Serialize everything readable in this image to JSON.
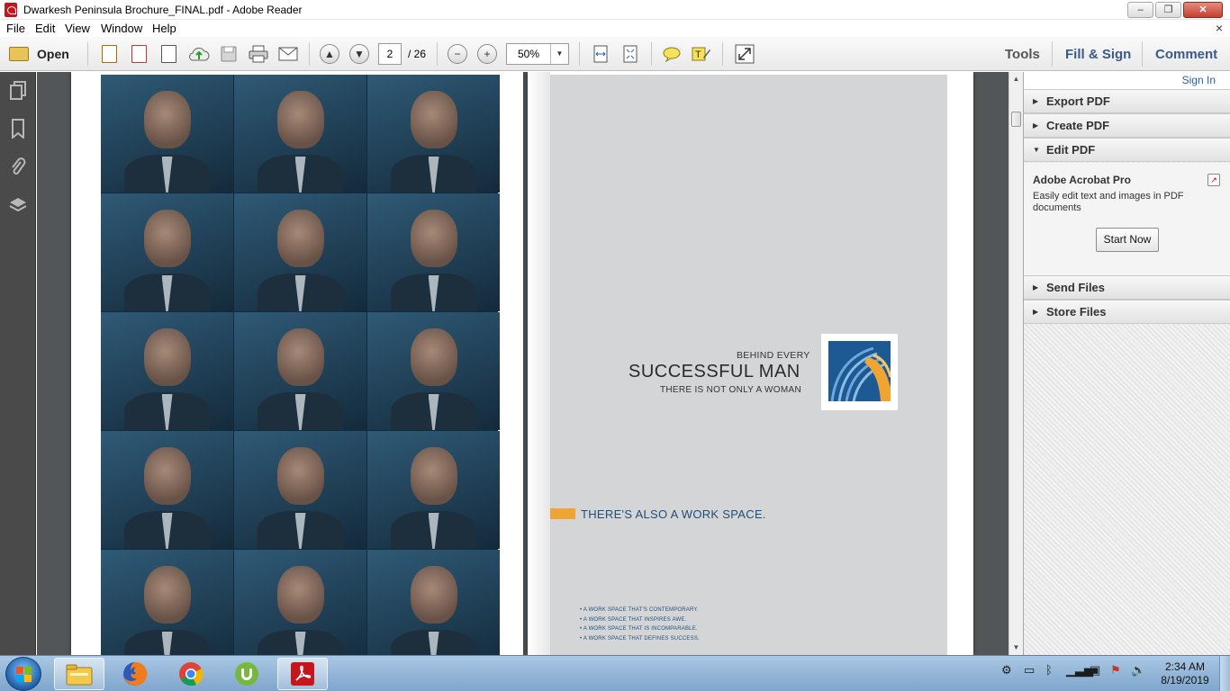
{
  "window": {
    "title": "Dwarkesh Peninsula Brochure_FINAL.pdf - Adobe Reader",
    "minimize": "–",
    "restore": "❐",
    "close": "✕"
  },
  "menu": {
    "items": [
      "File",
      "Edit",
      "View",
      "Window",
      "Help"
    ],
    "close_doc": "×"
  },
  "toolbar": {
    "open_label": "Open",
    "page_current": "2",
    "page_total": "/ 26",
    "zoom": "50%",
    "tools_label": "Tools",
    "fill_sign_label": "Fill & Sign",
    "comment_label": "Comment"
  },
  "document": {
    "behind_every": "BEHIND EVERY",
    "successful_man": "SUCCESSFUL MAN",
    "not_only": "THERE IS NOT ONLY A WOMAN",
    "work_space": "THERE'S ALSO A WORK SPACE.",
    "bullets": [
      "• A WORK SPACE THAT'S CONTEMPORARY.",
      "• A WORK SPACE THAT INSPIRES AWE.",
      "• A WORK SPACE THAT IS INCOMPARABLE.",
      "• A WORK SPACE THAT DEFINES SUCCESS."
    ],
    "accent_orange": "#f0a532",
    "accent_blue": "#1f4e7a"
  },
  "right_panel": {
    "sign_in": "Sign In",
    "sections": {
      "export": "Export PDF",
      "create": "Create PDF",
      "edit": "Edit PDF",
      "send": "Send Files",
      "store": "Store Files"
    },
    "acrobat_title": "Adobe Acrobat Pro",
    "acrobat_desc": "Easily edit text and images in PDF documents",
    "start_now": "Start Now"
  },
  "taskbar": {
    "apps": [
      "file-explorer",
      "firefox",
      "chrome",
      "utorrent",
      "adobe-reader"
    ],
    "time": "2:34 AM",
    "date": "8/19/2019"
  }
}
